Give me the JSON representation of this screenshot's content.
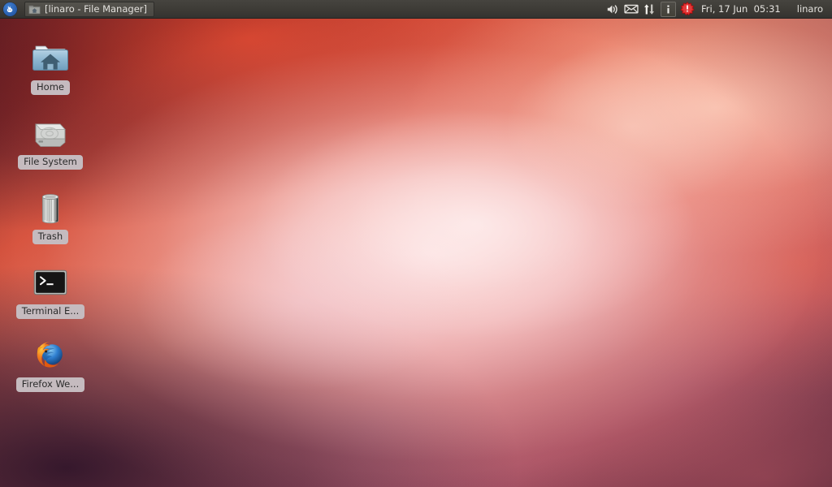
{
  "panel": {
    "menu_button": {
      "name": "whisker-menu",
      "icon": "mouse-icon"
    },
    "window_button": {
      "title": "[linaro - File Manager]",
      "icon": "home-folder-icon"
    },
    "tray": [
      {
        "name": "volume-icon",
        "icon": "speaker-icon"
      },
      {
        "name": "mail-icon",
        "icon": "envelope-icon"
      },
      {
        "name": "network-icon",
        "icon": "up-down-arrows-icon"
      },
      {
        "name": "info-icon",
        "icon": "information-icon",
        "label": "i"
      },
      {
        "name": "update-alert-icon",
        "icon": "red-starburst-alert-icon",
        "label": "!"
      }
    ],
    "clock": "Fri, 17 Jun  05:31",
    "user": "linaro"
  },
  "desktop": {
    "icons": [
      {
        "name": "home",
        "label": "Home",
        "icon": "home-folder-icon"
      },
      {
        "name": "file-system",
        "label": "File System",
        "icon": "hard-drive-icon"
      },
      {
        "name": "trash",
        "label": "Trash",
        "icon": "trash-can-icon"
      },
      {
        "name": "terminal",
        "label": "Terminal E...",
        "icon": "terminal-icon"
      },
      {
        "name": "firefox",
        "label": "Firefox We...",
        "icon": "firefox-icon"
      }
    ]
  },
  "colors": {
    "panel_bg": "#3d3b36",
    "panel_text": "#e4e2de",
    "label_bg": "#c5bbbf",
    "label_text": "#2b2b2b",
    "accent_blue": "#2d64b4",
    "alert_red": "#d81f1f",
    "wallpaper_top_left": "#3d1520",
    "wallpaper_top_right": "#e8705f",
    "wallpaper_bottom_left": "#3a1e33",
    "wallpaper_bottom_right": "#b85a63",
    "wallpaper_center": "#f5d5d8"
  }
}
